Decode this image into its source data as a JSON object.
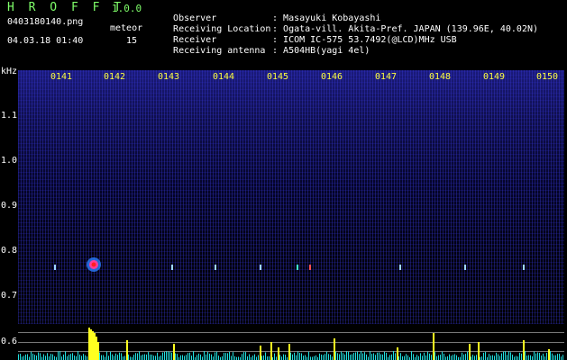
{
  "header": {
    "app_title": "H R O F F T",
    "version": "1.0.0",
    "file_name": "0403180140.png",
    "meteor_label": "meteor",
    "meteor_count": "15",
    "datetime": "04.03.18 01:40"
  },
  "info": [
    {
      "key": "Observer",
      "value": "Masayuki Kobayashi"
    },
    {
      "key": "Receiving Location",
      "value": "Ogata-vill. Akita-Pref. JAPAN (139.96E, 40.02N)"
    },
    {
      "key": "Receiver",
      "value": "ICOM IC-575 53.7492(@LCD)MHz USB"
    },
    {
      "key": "Receiving antenna",
      "value": "A504HB(yagi 4el)"
    }
  ],
  "axis": {
    "y_unit": "kHz",
    "y_ticks": [
      "1.1",
      "1.0",
      "0.9",
      "0.8",
      "0.7",
      "0.6"
    ],
    "x_ticks": [
      "0141",
      "0142",
      "0143",
      "0144",
      "0145",
      "0146",
      "0147",
      "0148",
      "0149",
      "0150"
    ]
  },
  "colors": {
    "title_green": "#7fff6a",
    "tick_yellow": "#ffff40",
    "meteor_red": "#ff3b3b",
    "power_cyan": "#20e0e0",
    "power_yellow": "#ffff20"
  }
}
